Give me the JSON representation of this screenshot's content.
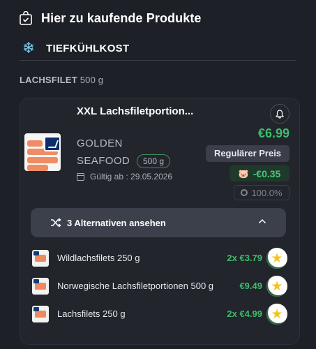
{
  "header": {
    "title": "Hier zu kaufende Produkte",
    "icon": "shopping-bag-check-icon"
  },
  "section": {
    "icon": "snowflake-icon",
    "icon_glyph": "❄",
    "label": "TIEFKÜHLKOST"
  },
  "group": {
    "name": "LACHSFILET",
    "size": "500 g"
  },
  "product": {
    "name": "XXL Lachsfiletportion...",
    "brand_line1": "GOLDEN",
    "brand_line2": "SEAFOOD",
    "size": "500 g",
    "valid_from": "Gültig ab : 29.05.2026",
    "price": "€6.99",
    "regular_label": "Regulärer Preis",
    "savings": "-€0.35",
    "percent": "100.0%"
  },
  "alternatives": {
    "toggle_label": "3 Alternativen ansehen",
    "items": [
      {
        "name": "Wildlachsfilets 250 g",
        "price": "2x €3.79",
        "badge_glyph": "★"
      },
      {
        "name": "Norwegische Lachsfiletportionen 500 g",
        "price": "€9.49",
        "badge_glyph": "★"
      },
      {
        "name": "Lachsfilets 250 g",
        "price": "2x €4.99",
        "badge_glyph": "★"
      }
    ]
  },
  "colors": {
    "background": "#1d2026",
    "accent_green": "#3dbd6a",
    "card": "#22252c"
  }
}
